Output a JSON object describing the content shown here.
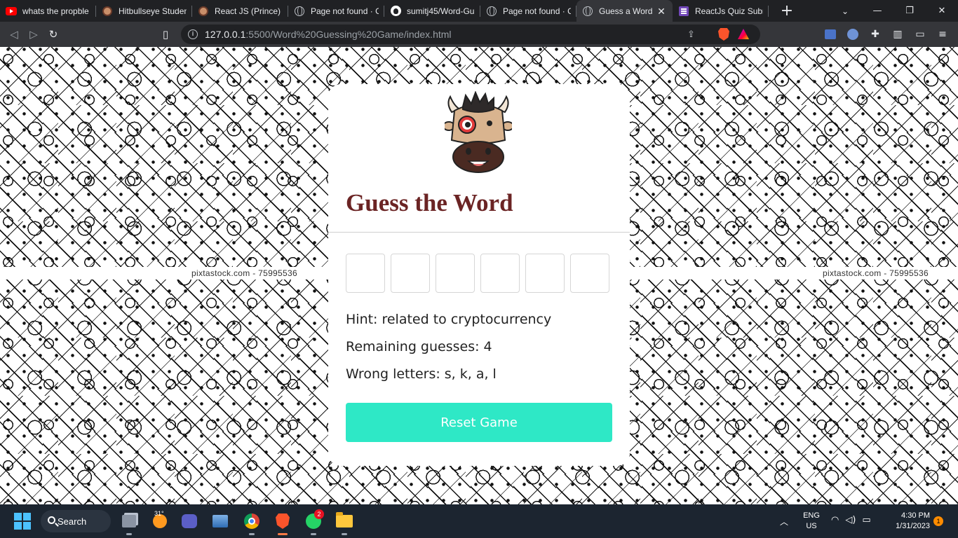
{
  "browser": {
    "tabs": [
      {
        "title": "whats the propble",
        "favicon": "youtube-icon",
        "active": false
      },
      {
        "title": "Hitbullseye Student",
        "favicon": "cow-icon",
        "active": false
      },
      {
        "title": "React JS (Prince) - Z",
        "favicon": "cow-icon",
        "active": false
      },
      {
        "title": "Page not found · G",
        "favicon": "globe-icon",
        "active": false
      },
      {
        "title": "sumitj45/Word-Gu",
        "favicon": "github-icon",
        "active": false
      },
      {
        "title": "Page not found · G",
        "favicon": "globe-icon",
        "active": false
      },
      {
        "title": "Guess a Word",
        "favicon": "globe-icon",
        "active": true,
        "close": "✕"
      },
      {
        "title": "ReactJs Quiz Subm",
        "favicon": "forms-icon",
        "active": false
      }
    ],
    "new_tab_label": "+",
    "url_host": "127.0.0.1",
    "url_path": ":5500/Word%20Guessing%20Game/index.html"
  },
  "page": {
    "watermark": "pixtastock.com - 75995536",
    "title": "Guess the Word",
    "letters": [
      "",
      "",
      "",
      "",
      "",
      ""
    ],
    "hint_label": "Hint:",
    "hint_value": "related to cryptocurrency",
    "remaining_label": "Remaining guesses:",
    "remaining_value": "4",
    "wrong_label": "Wrong letters:",
    "wrong_value": "s, k, a, l",
    "reset_label": "Reset Game",
    "colors": {
      "title": "#6b2424",
      "button": "#2ee8c6",
      "button_text": "#ffffff"
    }
  },
  "taskbar": {
    "search_label": "Search",
    "weather_temp": "31°",
    "whatsapp_badge": "2",
    "language_line1": "ENG",
    "language_line2": "US",
    "time": "4:30 PM",
    "date": "1/31/2023",
    "notification_count": "1"
  }
}
